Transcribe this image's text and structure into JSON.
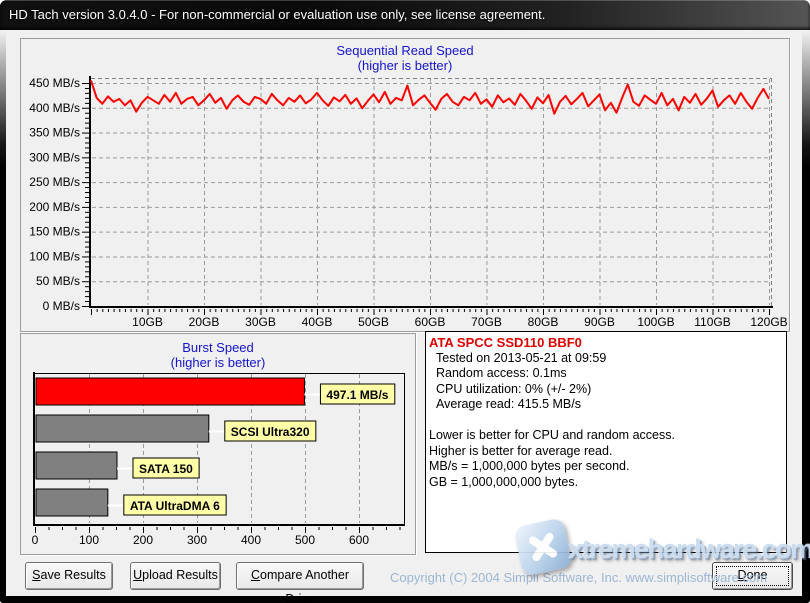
{
  "window": {
    "title": "HD Tach version 3.0.4.0  - For non-commercial or evaluation use only, see license agreement."
  },
  "sequential": {
    "title": "Sequential Read Speed",
    "subtitle": "(higher is better)"
  },
  "burst": {
    "title": "Burst Speed",
    "subtitle": "(higher is better)"
  },
  "info": {
    "drive": "ATA SPCC SSD110 BBF0",
    "lines": [
      "Tested on 2013-05-21 at 09:59",
      "Random access: 0.1ms",
      "CPU utilization: 0% (+/- 2%)",
      "Average read: 415.5 MB/s",
      "",
      "Lower is better for CPU and random access.",
      "Higher is better for average read.",
      "MB/s = 1,000,000 bytes per second.",
      "GB = 1,000,000,000 bytes."
    ]
  },
  "buttons": {
    "save": {
      "key": "S",
      "rest": "ave Results"
    },
    "upload": {
      "key": "U",
      "rest": "pload Results"
    },
    "compare": {
      "key": "C",
      "rest": "ompare Another Drive"
    },
    "done": {
      "key": "D",
      "rest": "one"
    }
  },
  "footer": {
    "copyright": "Copyright (C) 2004 Simpli Software, Inc. www.simplisoftware.com"
  },
  "watermark": {
    "text": "xtremehardware.com"
  },
  "colors": {
    "accent_blue": "#1414cc",
    "line_red": "#ff0000",
    "bar_gray": "#808080",
    "label_yellow": "#ffffa8",
    "drive_red": "#dd0000",
    "copyright_blue": "#9cb6d3"
  },
  "chart_data": [
    {
      "type": "line",
      "title": "Sequential Read Speed",
      "subtitle": "(higher is better)",
      "x_unit": "GB",
      "y_unit": "MB/s",
      "xlim": [
        0,
        120
      ],
      "ylim": [
        0,
        450
      ],
      "x_ticks": [
        10,
        20,
        30,
        40,
        50,
        60,
        70,
        80,
        90,
        100,
        110,
        120
      ],
      "y_ticks": [
        0,
        50,
        100,
        150,
        200,
        250,
        300,
        350,
        400,
        450
      ],
      "grid": true,
      "line_color": "#ff0000",
      "x_step": 1,
      "values": [
        455,
        420,
        408,
        423,
        412,
        418,
        405,
        415,
        392,
        410,
        422,
        415,
        408,
        426,
        412,
        430,
        408,
        418,
        422,
        405,
        415,
        428,
        410,
        420,
        398,
        415,
        425,
        412,
        406,
        422,
        418,
        408,
        428,
        415,
        405,
        420,
        412,
        425,
        409,
        417,
        430,
        415,
        404,
        421,
        413,
        426,
        408,
        419,
        399,
        414,
        427,
        411,
        432,
        408,
        420,
        415,
        445,
        405,
        416,
        425,
        410,
        396,
        418,
        428,
        412,
        405,
        422,
        415,
        430,
        408,
        417,
        402,
        425,
        411,
        419,
        406,
        428,
        414,
        398,
        421,
        409,
        426,
        388,
        412,
        424,
        407,
        418,
        430,
        403,
        415,
        427,
        395,
        410,
        390,
        420,
        447,
        412,
        404,
        425,
        416,
        408,
        430,
        405,
        418,
        395,
        422,
        410,
        428,
        406,
        419,
        435,
        402,
        415,
        425,
        408,
        430,
        412,
        398,
        420,
        438,
        418
      ]
    },
    {
      "type": "bar",
      "orientation": "horizontal",
      "title": "Burst Speed",
      "subtitle": "(higher is better)",
      "xlim": [
        0,
        687
      ],
      "x_ticks": [
        0,
        100,
        200,
        300,
        400,
        500,
        600
      ],
      "grid": true,
      "label_bg": "#ffffa8",
      "bars": [
        {
          "label": "497.1 MB/s",
          "value": 497.1,
          "color": "#ff0000"
        },
        {
          "label": "SCSI Ultra320",
          "value": 320,
          "color": "#808080"
        },
        {
          "label": "SATA 150",
          "value": 150,
          "color": "#808080"
        },
        {
          "label": "ATA UltraDMA 6",
          "value": 133,
          "color": "#808080"
        }
      ]
    }
  ]
}
